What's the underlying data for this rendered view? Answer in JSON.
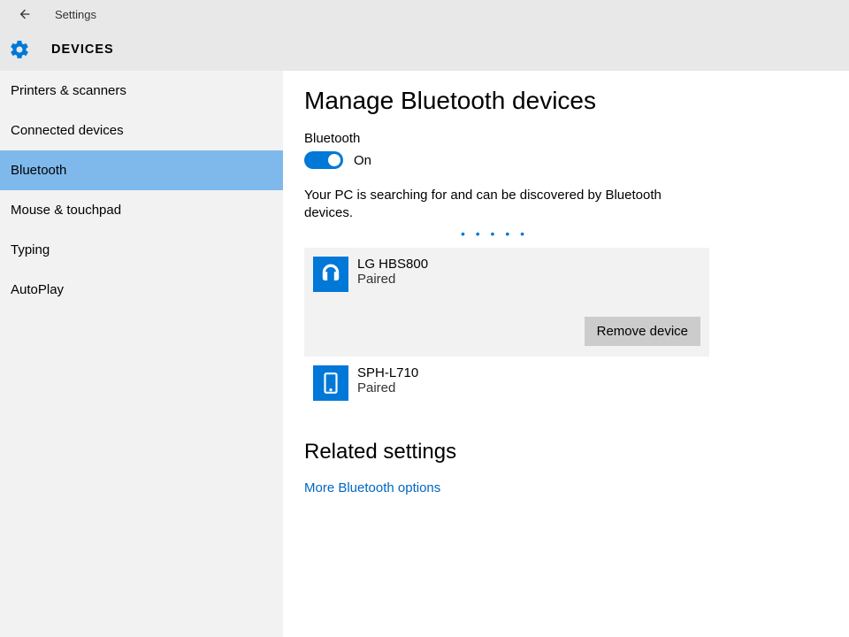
{
  "header": {
    "app_label": "Settings",
    "section_title": "DEVICES"
  },
  "sidebar": {
    "items": [
      {
        "label": "Printers & scanners",
        "selected": false
      },
      {
        "label": "Connected devices",
        "selected": false
      },
      {
        "label": "Bluetooth",
        "selected": true
      },
      {
        "label": "Mouse & touchpad",
        "selected": false
      },
      {
        "label": "Typing",
        "selected": false
      },
      {
        "label": "AutoPlay",
        "selected": false
      }
    ]
  },
  "main": {
    "title": "Manage Bluetooth devices",
    "toggle_label": "Bluetooth",
    "toggle_state_label": "On",
    "toggle_on": true,
    "status_text": "Your PC is searching for and can be discovered by Bluetooth devices.",
    "searching_indicator": "• • • •   •",
    "devices": [
      {
        "name": "LG HBS800",
        "status": "Paired",
        "icon": "headset",
        "selected": true
      },
      {
        "name": "SPH-L710",
        "status": "Paired",
        "icon": "phone",
        "selected": false
      }
    ],
    "remove_button_label": "Remove device",
    "related_title": "Related settings",
    "related_link": "More Bluetooth options"
  }
}
